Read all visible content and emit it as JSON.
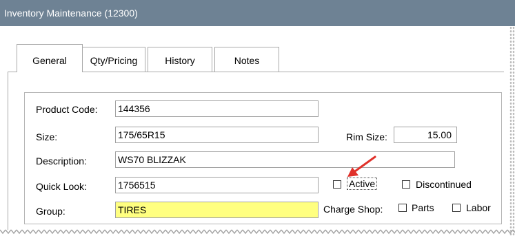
{
  "window": {
    "title": "Inventory Maintenance (12300)"
  },
  "tabs": [
    {
      "label": "General",
      "active": true
    },
    {
      "label": "Qty/Pricing",
      "active": false
    },
    {
      "label": "History",
      "active": false
    },
    {
      "label": "Notes",
      "active": false
    }
  ],
  "form": {
    "product_code": {
      "label": "Product Code:",
      "value": "144356"
    },
    "size": {
      "label": "Size:",
      "value": "175/65R15"
    },
    "rim_size": {
      "label": "Rim Size:",
      "value": "15.00"
    },
    "description": {
      "label": "Description:",
      "value": "WS70 BLIZZAK"
    },
    "quick_look": {
      "label": "Quick Look:",
      "value": "1756515"
    },
    "group": {
      "label": "Group:",
      "value": "TIRES"
    },
    "active": {
      "label": "Active",
      "checked": false
    },
    "discontinued": {
      "label": "Discontinued",
      "checked": false
    },
    "charge_shop": {
      "label": "Charge Shop:"
    },
    "parts": {
      "label": "Parts",
      "checked": false
    },
    "labor": {
      "label": "Labor",
      "checked": false
    }
  },
  "colors": {
    "titlebar": "#6e8294",
    "group_field": "#ffff80",
    "annotation_arrow": "#e0312a"
  }
}
